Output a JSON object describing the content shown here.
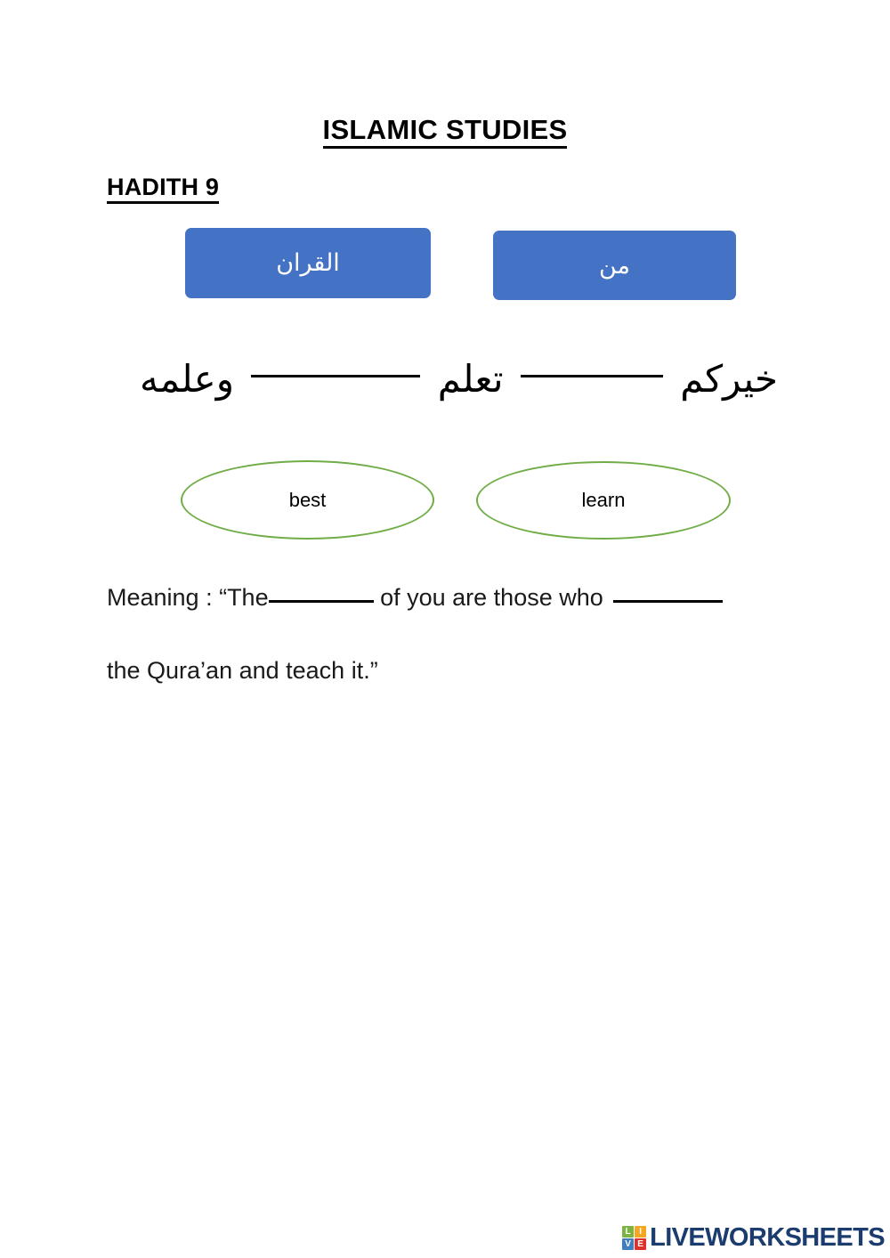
{
  "document": {
    "title": "ISLAMIC STUDIES",
    "section_title": "HADITH 9"
  },
  "word_bank": {
    "items": [
      {
        "id": "quran",
        "label": "القران",
        "color": "#4472C4",
        "text_color": "#FFFFFF"
      },
      {
        "id": "min",
        "label": "من",
        "color": "#4472C4",
        "text_color": "#FFFFFF"
      }
    ]
  },
  "arabic_sentence": {
    "word_1": "خيركم",
    "blank_1": "________",
    "word_2": "تعلم",
    "blank_2": "___________",
    "word_3": "وعلمه",
    "direction": "rtl"
  },
  "answer_options": {
    "outline_color": "#70AD47",
    "items": [
      {
        "id": "best",
        "label": "best"
      },
      {
        "id": "learn",
        "label": "learn"
      }
    ]
  },
  "meaning": {
    "prefix": "Meaning : “The",
    "blank_1": "_______",
    "middle": " of you are those who ",
    "blank_2": "_______",
    "line_2": "the Qura’an and teach it.”"
  },
  "footer": {
    "logo_tiles": [
      {
        "letter": "L",
        "color": "#7CB342"
      },
      {
        "letter": "I",
        "color": "#F5A623"
      },
      {
        "letter": "V",
        "color": "#3F7FBF"
      },
      {
        "letter": "E",
        "color": "#E0302E"
      }
    ],
    "logo_text": "LIVEWORKSHEETS",
    "logo_text_color": "#1B3C6E"
  }
}
